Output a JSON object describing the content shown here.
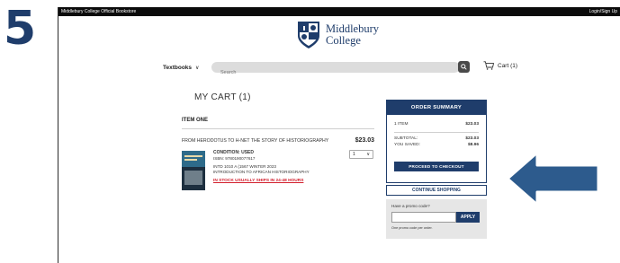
{
  "step": {
    "number": "5"
  },
  "topbar": {
    "store_name": "Middlebury College Official Bookstore",
    "login_label": "Login/Sign Up"
  },
  "header": {
    "college_line1": "Middlebury",
    "college_line2": "College"
  },
  "nav": {
    "textbooks_label": "Textbooks",
    "search_placeholder": "Search",
    "cart_label": "Cart (1)"
  },
  "cart": {
    "title": "MY CART (1)",
    "item": {
      "heading": "ITEM ONE",
      "title": "FROM HERODOTUS TO H-NET THE STORY OF HISTORIOGRAPHY",
      "price": "$23.03",
      "quantity": "1",
      "condition": "CONDITION: USED",
      "isbn": "ISBN: 9780190077617",
      "course_code": "INTD 1010 A (1567 WINTER 2023",
      "course_name": "INTRODUCTION TO AFRICAN HISTORIOGRAPHY",
      "stock_note": "IN STOCK USUALLY SHIPS IN 24-48 HOURS"
    }
  },
  "summary": {
    "header": "ORDER SUMMARY",
    "item_count": "1 ITEM",
    "item_total": "$23.03",
    "subtotal_label": "SUBTOTAL:",
    "subtotal": "$23.03",
    "saved_label": "YOU SAVED:",
    "saved": "$8.96",
    "checkout_label": "PROCEED TO CHECKOUT"
  },
  "continue_label": "CONTINUE SHOPPING",
  "promo": {
    "label": "Have a promo code?",
    "apply_label": "APPLY",
    "note": "One promo code per order."
  },
  "colors": {
    "navy": "#1f3d6b",
    "arrow": "#2d5b8d",
    "stock_red": "#d21f2d"
  }
}
